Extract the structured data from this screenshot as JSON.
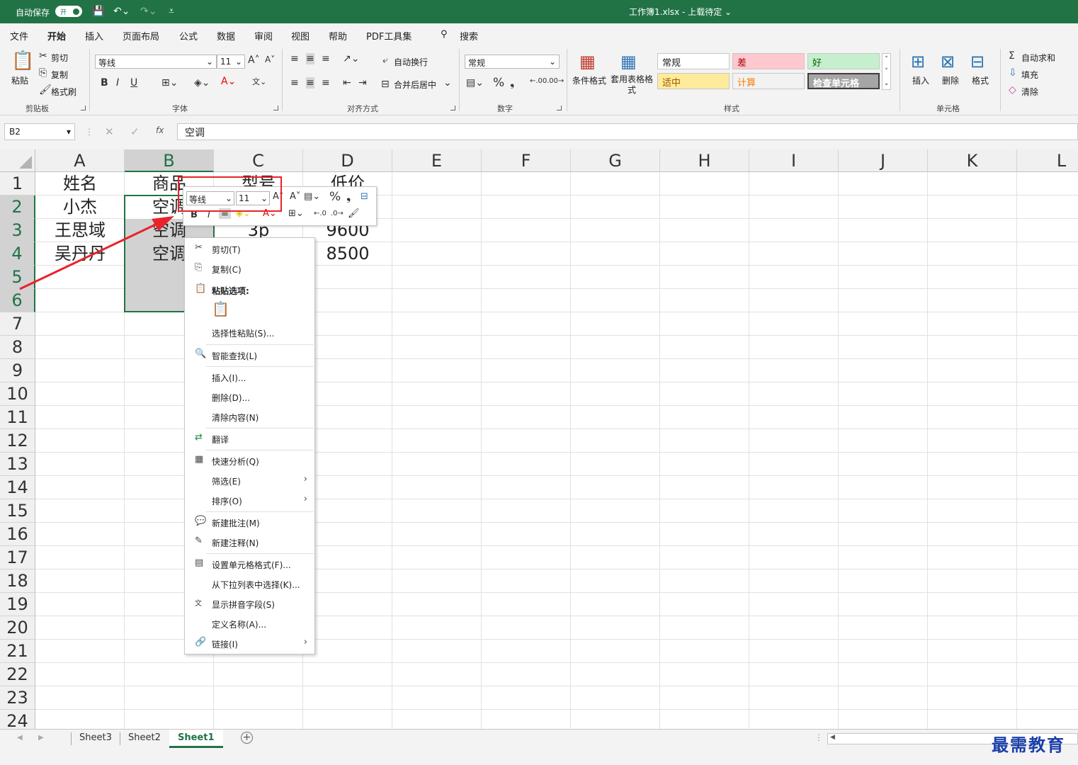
{
  "titlebar": {
    "autosave": "自动保存",
    "toggle": "开",
    "doc_title": "工作簿1.xlsx  -  上载待定  ⌄"
  },
  "menu_tabs": [
    "文件",
    "开始",
    "插入",
    "页面布局",
    "公式",
    "数据",
    "审阅",
    "视图",
    "帮助",
    "PDF工具集",
    "搜索"
  ],
  "ribbon": {
    "clipboard": {
      "paste": "粘贴",
      "cut": "剪切",
      "copy": "复制",
      "format_painter": "格式刷",
      "group": "剪贴板"
    },
    "font": {
      "name": "等线",
      "size": "11",
      "group": "字体",
      "bold": "B",
      "italic": "I",
      "underline": "U"
    },
    "alignment": {
      "wrap": "自动换行",
      "merge": "合并后居中",
      "group": "对齐方式"
    },
    "number": {
      "format": "常规",
      "percent": "%",
      "group": "数字"
    },
    "styles": {
      "cond_format": "条件格式",
      "table_format": "套用表格格式",
      "normal": "常规",
      "bad": "差",
      "good": "好",
      "neutral": "适中",
      "calc": "计算",
      "check": "检查单元格",
      "group": "样式"
    },
    "cells": {
      "insert": "插入",
      "delete": "删除",
      "format": "格式",
      "group": "单元格"
    },
    "editing": {
      "autosum": "自动求和",
      "fill": "填充",
      "clear": "清除"
    }
  },
  "formula": {
    "namebox": "B2",
    "fx": "fx",
    "value": "空调"
  },
  "columns": [
    "A",
    "B",
    "C",
    "D",
    "E",
    "F",
    "G",
    "H",
    "I",
    "J",
    "K",
    "L"
  ],
  "rows": [
    "1",
    "2",
    "3",
    "4",
    "5",
    "6",
    "7",
    "8",
    "9",
    "10",
    "11",
    "12",
    "13",
    "14",
    "15",
    "16",
    "17",
    "18",
    "19",
    "20",
    "21",
    "22",
    "23",
    "24"
  ],
  "cells": {
    "A1": "姓名",
    "B1": "商品",
    "C1": "型号",
    "D1": "低价",
    "A2": "小杰",
    "B2": "空调",
    "A3": "王思域",
    "B3": "空调",
    "C3": "3p",
    "D3": "9600",
    "A4": "吴丹丹",
    "B4": "空调",
    "D4": "8500"
  },
  "mini_toolbar": {
    "font": "等线",
    "size": "11",
    "bold": "B",
    "italic": "I"
  },
  "context_menu": [
    {
      "label": "剪切(T)",
      "icon": "✂"
    },
    {
      "label": "复制(C)",
      "icon": "⎘"
    },
    {
      "label": "粘贴选项:",
      "icon": "📋"
    },
    {
      "label": "选择性粘贴(S)...",
      "icon": ""
    },
    {
      "label": "智能查找(L)",
      "icon": "🔍"
    },
    {
      "label": "插入(I)...",
      "icon": ""
    },
    {
      "label": "删除(D)...",
      "icon": ""
    },
    {
      "label": "清除内容(N)",
      "icon": ""
    },
    {
      "label": "翻译",
      "icon": "⇄"
    },
    {
      "label": "快速分析(Q)",
      "icon": "▦"
    },
    {
      "label": "筛选(E)",
      "icon": ""
    },
    {
      "label": "排序(O)",
      "icon": ""
    },
    {
      "label": "新建批注(M)",
      "icon": "💬"
    },
    {
      "label": "新建注释(N)",
      "icon": "✎"
    },
    {
      "label": "设置单元格格式(F)...",
      "icon": "▤"
    },
    {
      "label": "从下拉列表中选择(K)...",
      "icon": ""
    },
    {
      "label": "显示拼音字段(S)",
      "icon": "文"
    },
    {
      "label": "定义名称(A)...",
      "icon": ""
    },
    {
      "label": "链接(I)",
      "icon": "🔗"
    }
  ],
  "sheets": [
    "Sheet3",
    "Sheet2",
    "Sheet1"
  ],
  "watermark": "最需教育",
  "colors": {
    "excel_green": "#217346",
    "annotation_red": "#e8232a"
  }
}
